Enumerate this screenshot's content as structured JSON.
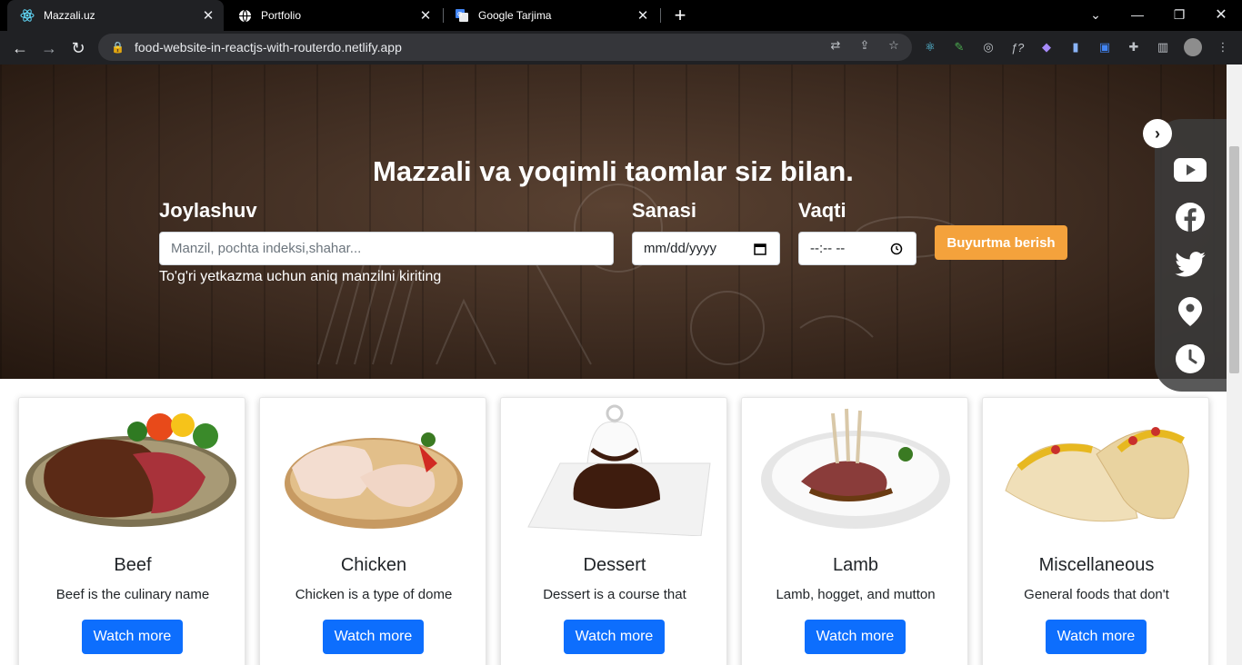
{
  "browser": {
    "tabs": [
      {
        "title": "Mazzali.uz",
        "icon": "react-icon",
        "active": true
      },
      {
        "title": "Portfolio",
        "icon": "globe-icon",
        "active": false
      },
      {
        "title": "Google Tarjima",
        "icon": "google-translate-icon",
        "active": false
      }
    ],
    "url": "food-website-in-reactjs-with-routerdo.netlify.app"
  },
  "hero": {
    "title": "Mazzali va yoqimli taomlar siz bilan.",
    "location_label": "Joylashuv",
    "location_placeholder": "Manzil, pochta indeksi,shahar...",
    "location_hint": "To'g'ri yetkazma uchun aniq manzilni kiriting",
    "date_label": "Sanasi",
    "date_value": "mm/dd/yyyy",
    "time_label": "Vaqti",
    "time_value": "--:-- --",
    "order_button": "Buyurtma berish"
  },
  "social": [
    "youtube-icon",
    "facebook-icon",
    "twitter-icon",
    "location-pin-icon",
    "clock-icon"
  ],
  "categories": [
    {
      "title": "Beef",
      "text": "Beef is the culinary name",
      "button": "Watch more"
    },
    {
      "title": "Chicken",
      "text": "Chicken is a type of dome",
      "button": "Watch more"
    },
    {
      "title": "Dessert",
      "text": "Dessert is a course that",
      "button": "Watch more"
    },
    {
      "title": "Lamb",
      "text": "Lamb, hogget, and mutton",
      "button": "Watch more"
    },
    {
      "title": "Miscellaneous",
      "text": "General foods that don't",
      "button": "Watch more"
    }
  ],
  "colors": {
    "accent": "#f4a23c",
    "primary": "#0d6efd"
  }
}
